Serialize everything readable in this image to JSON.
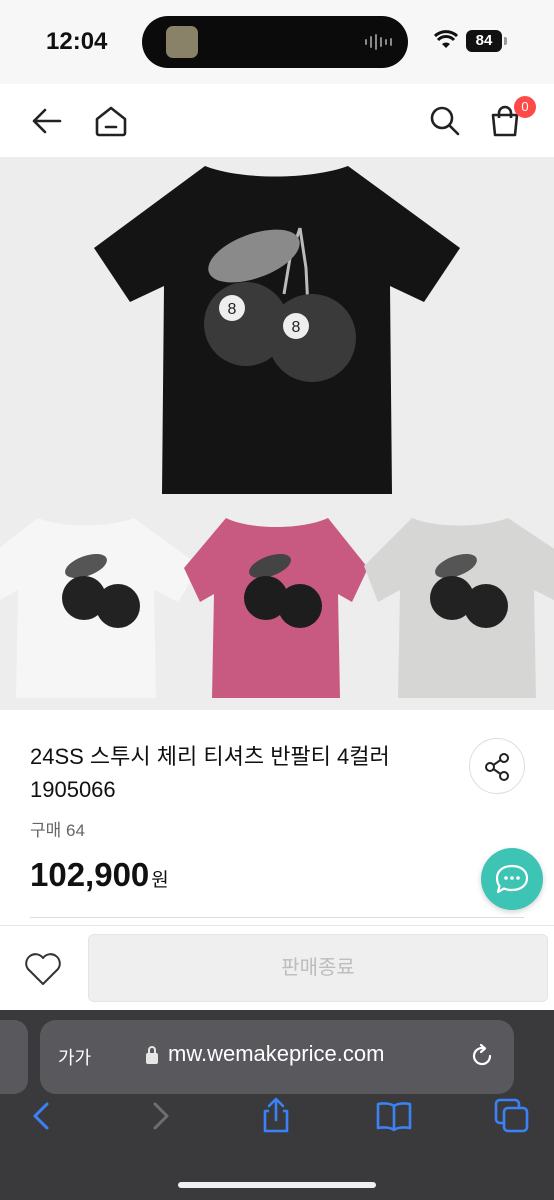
{
  "status_bar": {
    "time": "12:04",
    "battery": "84",
    "icons": [
      "now-playing-thumbnail-icon",
      "audio-waveform-icon",
      "wifi-icon",
      "battery-icon"
    ]
  },
  "header": {
    "icons": [
      "back-arrow-icon",
      "home-icon",
      "search-icon",
      "shopping-bag-icon"
    ],
    "cart_count": "0",
    "badge_color": "#ff4a4a"
  },
  "product": {
    "image_description_colors": [
      "#111111",
      "#f4f4f4",
      "#c85a82",
      "#d6d6d4"
    ],
    "title": "24SS 스투시 체리 티셔츠 반팔티 4컬러 1905066",
    "purchase_count": "구매 64",
    "price": "102,900",
    "currency": "원"
  },
  "actions": {
    "share_icon": "share-icon",
    "chat_icon": "chat-bubble-icon",
    "chat_color": "#3ec4b5",
    "wishlist_icon": "heart-icon",
    "buy_button_label": "판매종료"
  },
  "browser": {
    "text_size_label": "가가",
    "url": "mw.wemakeprice.com",
    "toolbar_icons": [
      "back-icon",
      "forward-icon",
      "share-icon",
      "bookmarks-icon",
      "tabs-icon"
    ],
    "accent": "#3b82f6"
  }
}
